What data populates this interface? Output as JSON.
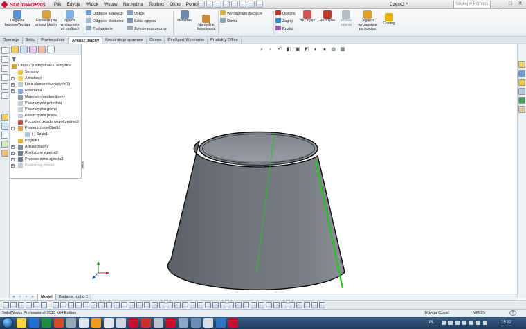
{
  "titlebar": {
    "brand_ds": "3DS",
    "brand_name": "SOLIDWORKS",
    "menu": [
      "Plik",
      "Edycja",
      "Widok",
      "Wstaw",
      "Narzędzia",
      "Toolbox",
      "Okno",
      "Pomoc"
    ],
    "doc_title": "Część2 *",
    "help_search_placeholder": "Szukaj w Pomocy",
    "window_controls": [
      "_",
      "□",
      "✕"
    ]
  },
  "ribbon": {
    "odgiecie_bazowe": "Odgięcie bazowe/Wyciąg",
    "konwertuj": "Konwertuj na arkusz blachy",
    "zgiecie_wyciagniete": "Zgięcie wyciągnięte po profilach",
    "odgiecie_krawedzi": "Odgięcie krawędzi",
    "odgiecie_dookolne": "Odgięcie dookolne",
    "podwiniecie": "Podwinięcie",
    "uskok": "Uskok",
    "szkic_zgiecia": "Szkic zgięcia",
    "zgiecie_poprzeczne": "Zgięcie poprzeczne",
    "narozniki": "Narożniki",
    "narzedzie_formowania": "Narzędzie formowania",
    "wyciagniete_wyciecie": "Wyciągnięte wycięcie",
    "otwor": "Otwór",
    "odegnij": "Odegnij",
    "zagnij": "Zagnij",
    "rozloz": "Rozłóż",
    "bez_zgiec": "Bez zgięć",
    "rozciecie": "Rozcięcie",
    "wstaw_zgiecia": "Wstaw zgięcia",
    "odgiecie_wyciagniete": "Odgięcie wyciągnięte po ścieżce",
    "costing": "Costing"
  },
  "cm_tabs": [
    "Operacje",
    "Szkic",
    "Powierzchnie",
    "Arkusz blachy",
    "Konstrukcje spawane",
    "Ocena",
    "DimXpert Wymiarów",
    "Produkty Office"
  ],
  "cm_tab_active": "Arkusz blachy",
  "feature_tree": {
    "root": "Część2  (Domyślna<<Domyślna",
    "items": [
      "Sensory",
      "Adnotacje",
      "Lista elementów ciętych(1)",
      "Równania",
      "Materiał <nieokreślony>",
      "Płaszczyzna przednia",
      "Płaszczyzna górna",
      "Płaszczyzna prawa",
      "Początek układu współrzędnych",
      "Powierzchnia-Obrót1",
      "(-) Szkic1",
      "Pogrub1",
      "Arkusz blachy",
      "Rozłożone zgięcia3",
      "Przetworzone zgięcia3",
      "Rozłożony model"
    ]
  },
  "bottom_tabs": [
    "Model",
    "Badanie ruchu 1"
  ],
  "bottom_tab_active": "Model",
  "status": {
    "app": "SolidWorks Professional 2013 x64 Edition",
    "mode": "Edycja Część",
    "units": "MMGS",
    "help": "?"
  },
  "taskbar": {
    "lang": "PL",
    "time": "15:22"
  },
  "colors": {
    "part_face": "#6e737a",
    "part_edge": "#0a0a0a",
    "selected_edge": "#22c41e",
    "active_tab": "#ffffff",
    "ribbon_bg": "#eef1f4"
  }
}
